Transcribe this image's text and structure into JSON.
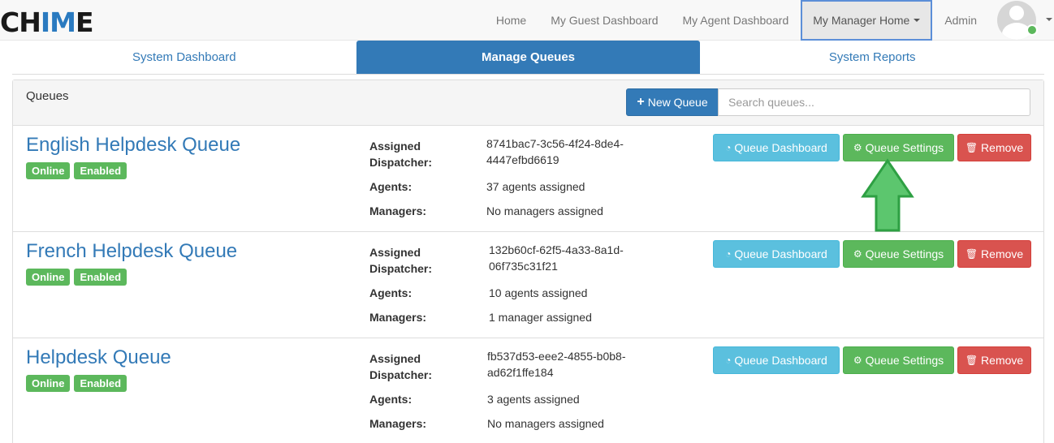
{
  "brand": {
    "logo_prefix": "CH",
    "logo_highlight": "IM",
    "logo_suffix": "E"
  },
  "nav": {
    "items": [
      {
        "label": "Home"
      },
      {
        "label": "My Guest Dashboard"
      },
      {
        "label": "My Agent Dashboard"
      },
      {
        "label": "My Manager Home"
      },
      {
        "label": "Admin"
      }
    ],
    "avatar_status_color": "#5cb85c"
  },
  "tabs": [
    {
      "label": "System Dashboard"
    },
    {
      "label": "Manage Queues"
    },
    {
      "label": "System Reports"
    }
  ],
  "panel": {
    "title": "Queues",
    "new_queue_label": "New Queue",
    "search_placeholder": "Search queues..."
  },
  "field_labels": {
    "dispatcher_line1": "Assigned",
    "dispatcher_line2": "Dispatcher:",
    "agents": "Agents:",
    "managers": "Managers:"
  },
  "buttons": {
    "dashboard": "Queue Dashboard",
    "settings": "Queue Settings",
    "remove": "Remove"
  },
  "queues": [
    {
      "name": "English Helpdesk Queue",
      "status": "Online",
      "state": "Enabled",
      "dispatcher_line1": "8741bac7-3c56-4f24-8de4-",
      "dispatcher_line2": "4447efbd6619",
      "agents": "37 agents assigned",
      "managers": "No managers assigned"
    },
    {
      "name": "French Helpdesk Queue",
      "status": "Online",
      "state": "Enabled",
      "dispatcher_line1": "132b60cf-62f5-4a33-8a1d-",
      "dispatcher_line2": "06f735c31f21",
      "agents": "10 agents assigned",
      "managers": "1 manager assigned"
    },
    {
      "name": "Helpdesk Queue",
      "status": "Online",
      "state": "Enabled",
      "dispatcher_line1": "fb537d53-eee2-4855-b0b8-",
      "dispatcher_line2": "ad62f1ffe184",
      "agents": "3 agents assigned",
      "managers": "No managers assigned"
    }
  ],
  "colors": {
    "primary": "#337ab7",
    "success": "#5cb85c",
    "info": "#5bc0de",
    "danger": "#d9534f",
    "annotation_arrow": "#5cc66e"
  }
}
